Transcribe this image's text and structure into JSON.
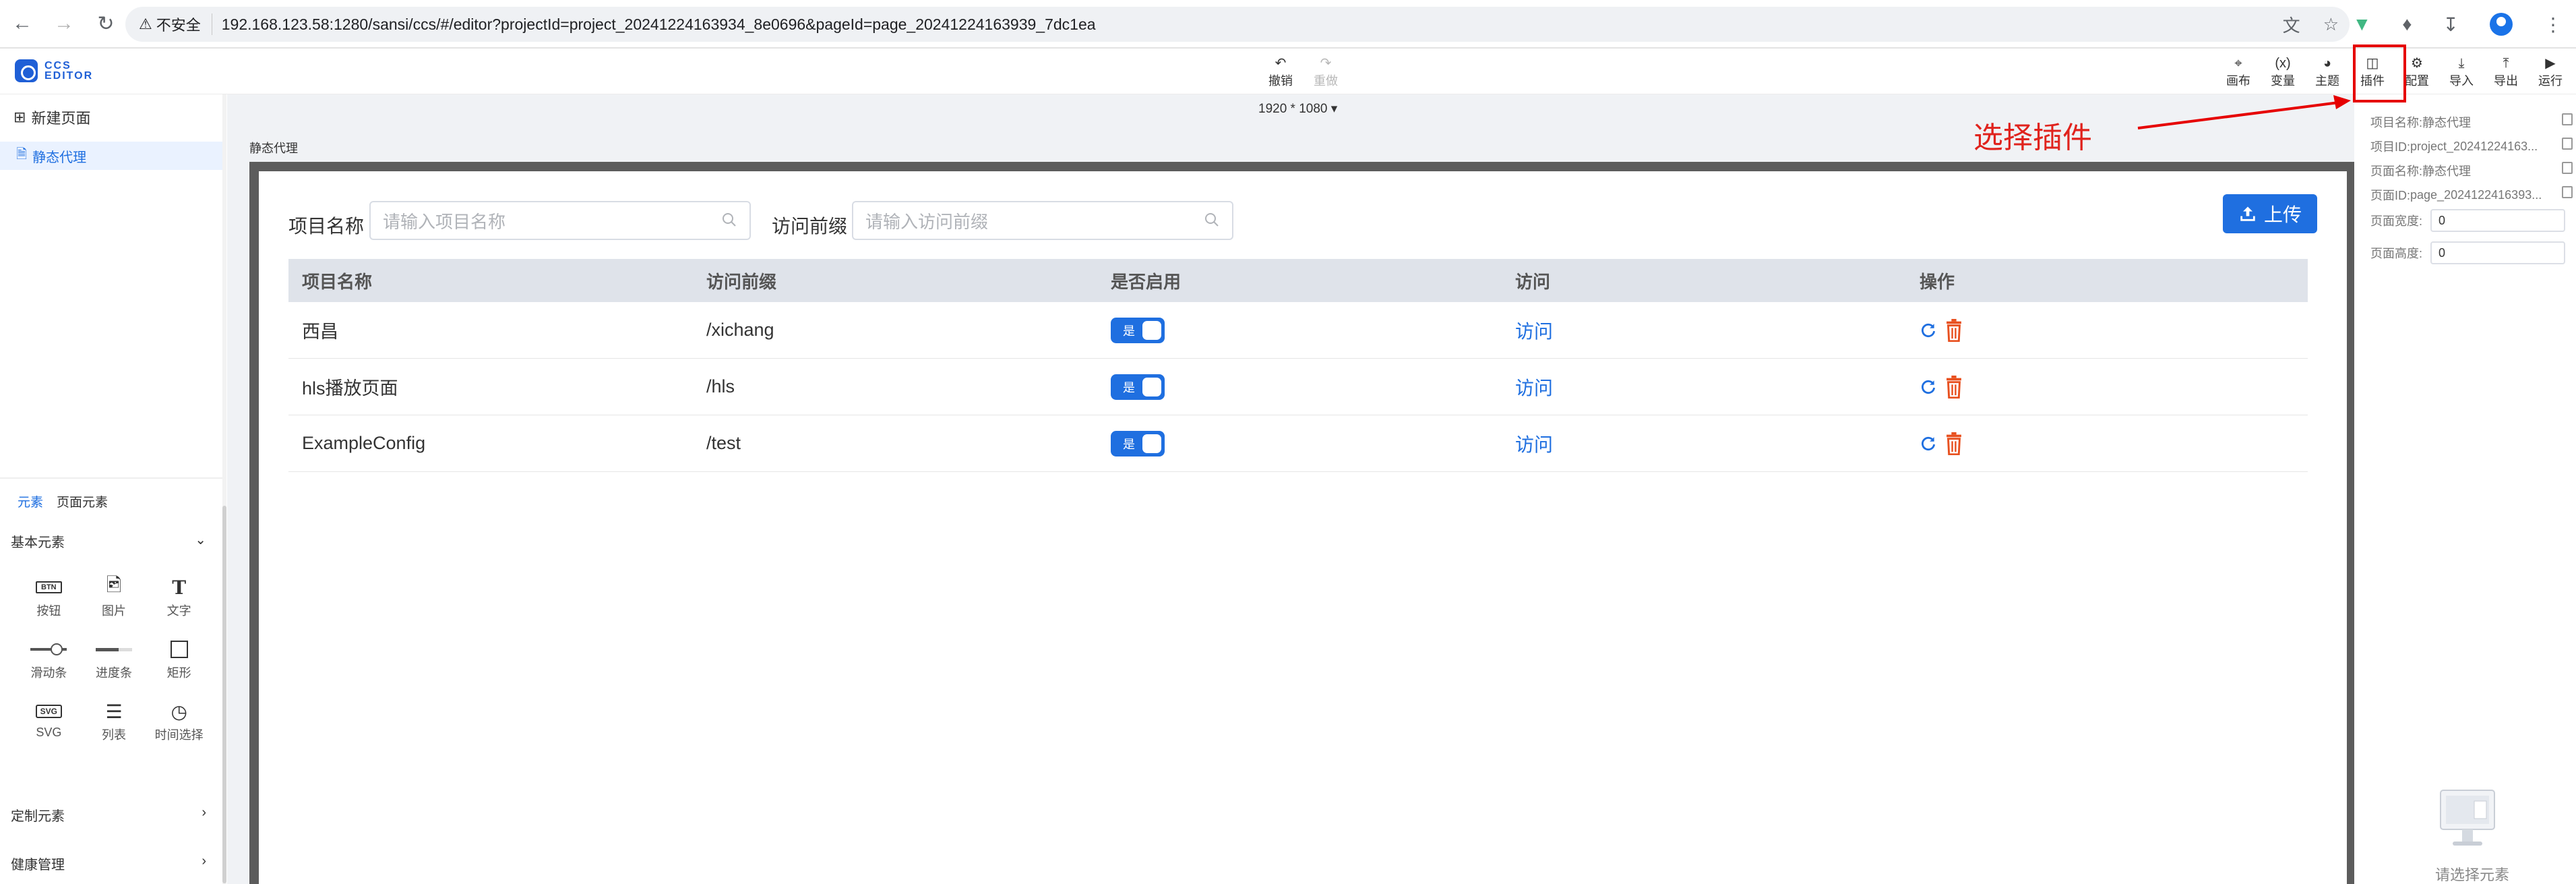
{
  "browser": {
    "insecure_label": "不安全",
    "url": "192.168.123.58:1280/sansi/ccs/#/editor?projectId=project_20241224163934_8e0696&pageId=page_20241224163939_7dc1ea"
  },
  "app": {
    "logo_line1": "CCS",
    "logo_line2": "EDITOR",
    "undo_label": "撤销",
    "redo_label": "重做",
    "right_toolbar": [
      "画布",
      "变量",
      "主题",
      "插件",
      "配置",
      "导入",
      "导出",
      "运行"
    ]
  },
  "left_panel": {
    "new_page_label": "新建页面",
    "pages": [
      "静态代理"
    ],
    "tabs": [
      "元素",
      "页面元素"
    ],
    "groups": {
      "basic": "基本元素",
      "custom": "定制元素",
      "health": "健康管理"
    },
    "elements": [
      {
        "label": "按钮",
        "icon": "button-icon"
      },
      {
        "label": "图片",
        "icon": "image-icon"
      },
      {
        "label": "文字",
        "icon": "text-icon"
      },
      {
        "label": "滑动条",
        "icon": "slider-icon"
      },
      {
        "label": "进度条",
        "icon": "progress-icon"
      },
      {
        "label": "矩形",
        "icon": "rectangle-icon"
      },
      {
        "label": "SVG",
        "icon": "svg-icon"
      },
      {
        "label": "列表",
        "icon": "list-icon"
      },
      {
        "label": "时间选择",
        "icon": "clock-icon"
      }
    ]
  },
  "canvas": {
    "resolution": "1920 * 1080",
    "page_caption": "静态代理",
    "search": {
      "project_label": "项目名称",
      "project_placeholder": "请输入项目名称",
      "prefix_label": "访问前缀",
      "prefix_placeholder": "请输入访问前缀"
    },
    "upload_label": "上传",
    "table": {
      "headers": [
        "项目名称",
        "访问前缀",
        "是否启用",
        "访问",
        "操作"
      ],
      "rows": [
        {
          "name": "西昌",
          "prefix": "/xichang",
          "enabled": "是",
          "visit": "访问"
        },
        {
          "name": "hls播放页面",
          "prefix": "/hls",
          "enabled": "是",
          "visit": "访问"
        },
        {
          "name": "ExampleConfig",
          "prefix": "/test",
          "enabled": "是",
          "visit": "访问"
        }
      ]
    }
  },
  "annotation": {
    "text": "选择插件",
    "color": "#e0231d"
  },
  "right_panel": {
    "project_name_label": "项目名称:",
    "project_name_value": "静态代理",
    "project_id_label": "项目ID:",
    "project_id_value": "project_20241224163...",
    "page_name_label": "页面名称:",
    "page_name_value": "静态代理",
    "page_id_label": "页面ID:",
    "page_id_value": "page_2024122416393...",
    "width_label": "页面宽度:",
    "width_value": "0",
    "height_label": "页面高度:",
    "height_value": "0",
    "empty_text": "请选择元素"
  },
  "colors": {
    "accent": "#1f6fe0",
    "annotation_red": "#e60000",
    "delete_icon": "#e8501f"
  }
}
